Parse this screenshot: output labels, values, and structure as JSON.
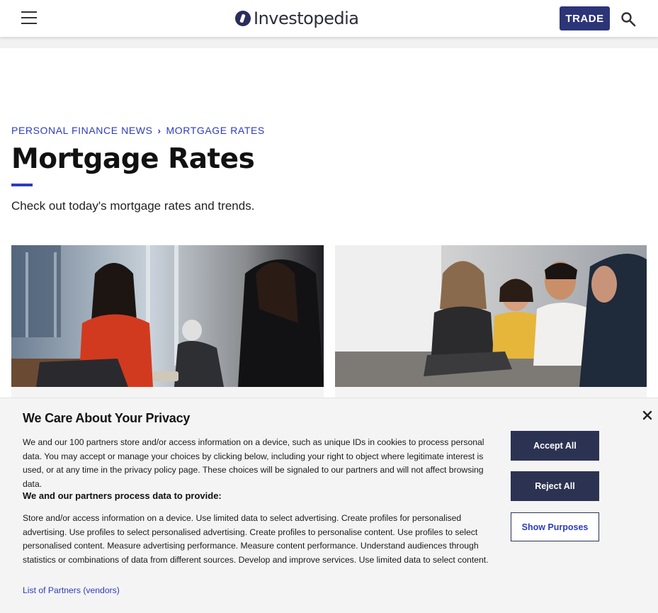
{
  "header": {
    "logo_text": "Investopedia",
    "trade_label": "TRADE"
  },
  "breadcrumb": {
    "items": [
      "PERSONAL FINANCE NEWS",
      "MORTGAGE RATES"
    ],
    "separator": "›"
  },
  "page": {
    "title": "Mortgage Rates",
    "subtitle": "Check out today's mortgage rates and trends."
  },
  "colors": {
    "brand": "#2c3577",
    "link": "#2c3bbf",
    "button_dark": "#2c3352"
  },
  "privacy": {
    "title": "We Care About Your Privacy",
    "body": "We and our 100 partners store and/or access information on a device, such as unique IDs in cookies to process personal data. You may accept or manage your choices by clicking below, including your right to object where legitimate interest is used, or at any time in the privacy policy page. These choices will be signaled to our partners and will not affect browsing data.",
    "subheading": "We and our partners process data to provide:",
    "purposes": "Store and/or access information on a device. Use limited data to select advertising. Create profiles for personalised advertising. Use profiles to select personalised advertising. Create profiles to personalise content. Use profiles to select personalised content. Measure advertising performance. Measure content performance. Understand audiences through statistics or combinations of data from different sources. Develop and improve services. Use limited data to select content.",
    "partners_link": "List of Partners (vendors)",
    "accept_label": "Accept All",
    "reject_label": "Reject All",
    "purposes_label": "Show Purposes"
  },
  "icons": {
    "menu": "hamburger-menu-icon",
    "search": "search-icon",
    "close": "close-icon",
    "chevron": "chevron-right-icon"
  }
}
